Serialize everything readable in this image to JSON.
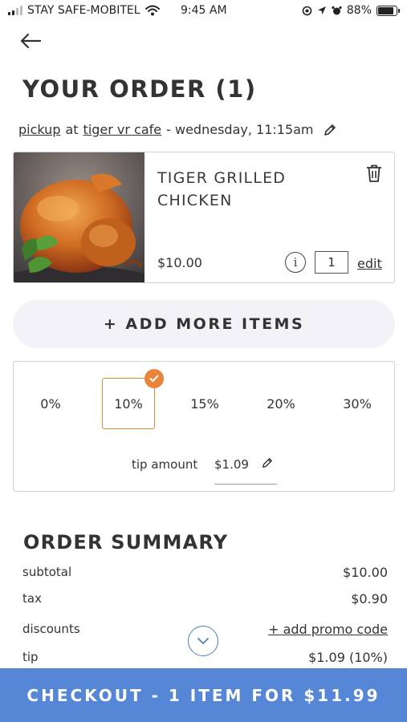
{
  "status_bar": {
    "carrier": "STAY SAFE-MOBITEL",
    "time": "9:45 AM",
    "battery": "88%"
  },
  "header": {
    "title": "YOUR ORDER (1)"
  },
  "pickup": {
    "mode": "pickup",
    "at": "at",
    "location": "tiger vr cafe",
    "when": "- wednesday, 11:15am"
  },
  "item": {
    "name": "TIGER GRILLED CHICKEN",
    "price": "$10.00",
    "info": "i",
    "quantity": "1",
    "edit_label": "edit"
  },
  "add_more_label": "+ ADD MORE ITEMS",
  "tip": {
    "options": [
      "0%",
      "10%",
      "15%",
      "20%",
      "30%"
    ],
    "selected_index": 1,
    "amount_label": "tip amount",
    "amount_value": "$1.09"
  },
  "summary": {
    "title": "ORDER SUMMARY",
    "subtotal_label": "subtotal",
    "subtotal_value": "$10.00",
    "tax_label": "tax",
    "tax_value": "$0.90",
    "discounts_label": "discounts",
    "promo_label": "+ add promo code",
    "tip_label": "tip",
    "tip_value": "$1.09 (10%)"
  },
  "checkout_label": "CHECKOUT - 1 ITEM FOR $11.99",
  "colors": {
    "accent_orange": "#e9853a",
    "checkout_blue": "#5686d6"
  }
}
